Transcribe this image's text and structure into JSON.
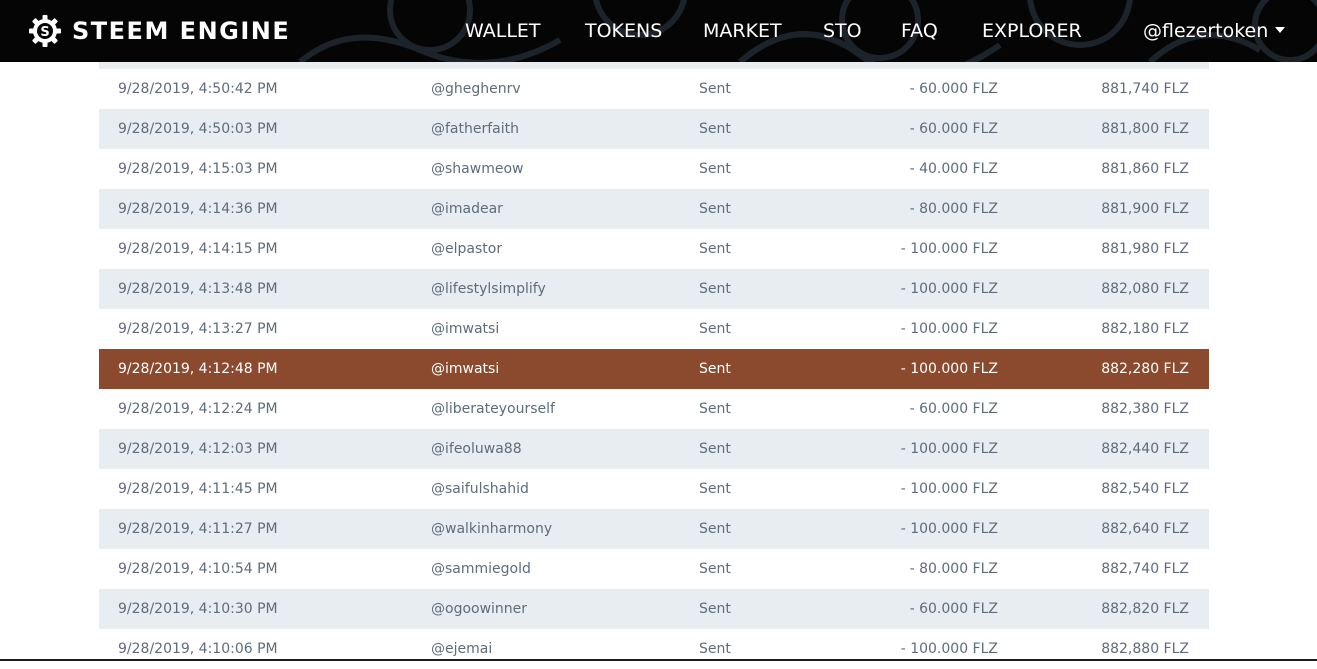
{
  "header": {
    "brand": "STEEM ENGINE",
    "nav": [
      "WALLET",
      "TOKENS",
      "MARKET",
      "STO",
      "FAQ",
      "EXPLORER"
    ],
    "user": "@flezertoken"
  },
  "colors": {
    "navbar_bg": "#050505",
    "row_alt_bg": "#e8edf1",
    "row_selected_bg": "#8b4a2e",
    "text": "#5e6c7b"
  },
  "transactions": [
    {
      "date": "9/28/2019, 4:50:42 PM",
      "user": "@gheghenrv",
      "type": "Sent",
      "amount": "- 60.000 FLZ",
      "balance": "881,740 FLZ"
    },
    {
      "date": "9/28/2019, 4:50:03 PM",
      "user": "@fatherfaith",
      "type": "Sent",
      "amount": "- 60.000 FLZ",
      "balance": "881,800 FLZ"
    },
    {
      "date": "9/28/2019, 4:15:03 PM",
      "user": "@shawmeow",
      "type": "Sent",
      "amount": "- 40.000 FLZ",
      "balance": "881,860 FLZ"
    },
    {
      "date": "9/28/2019, 4:14:36 PM",
      "user": "@imadear",
      "type": "Sent",
      "amount": "- 80.000 FLZ",
      "balance": "881,900 FLZ"
    },
    {
      "date": "9/28/2019, 4:14:15 PM",
      "user": "@elpastor",
      "type": "Sent",
      "amount": "- 100.000 FLZ",
      "balance": "881,980 FLZ"
    },
    {
      "date": "9/28/2019, 4:13:48 PM",
      "user": "@lifestylsimplify",
      "type": "Sent",
      "amount": "- 100.000 FLZ",
      "balance": "882,080 FLZ"
    },
    {
      "date": "9/28/2019, 4:13:27 PM",
      "user": "@imwatsi",
      "type": "Sent",
      "amount": "- 100.000 FLZ",
      "balance": "882,180 FLZ"
    },
    {
      "date": "9/28/2019, 4:12:48 PM",
      "user": "@imwatsi",
      "type": "Sent",
      "amount": "- 100.000 FLZ",
      "balance": "882,280 FLZ"
    },
    {
      "date": "9/28/2019, 4:12:24 PM",
      "user": "@liberateyourself",
      "type": "Sent",
      "amount": "- 60.000 FLZ",
      "balance": "882,380 FLZ"
    },
    {
      "date": "9/28/2019, 4:12:03 PM",
      "user": "@ifeoluwa88",
      "type": "Sent",
      "amount": "- 100.000 FLZ",
      "balance": "882,440 FLZ"
    },
    {
      "date": "9/28/2019, 4:11:45 PM",
      "user": "@saifulshahid",
      "type": "Sent",
      "amount": "- 100.000 FLZ",
      "balance": "882,540 FLZ"
    },
    {
      "date": "9/28/2019, 4:11:27 PM",
      "user": "@walkinharmony",
      "type": "Sent",
      "amount": "- 100.000 FLZ",
      "balance": "882,640 FLZ"
    },
    {
      "date": "9/28/2019, 4:10:54 PM",
      "user": "@sammiegold",
      "type": "Sent",
      "amount": "- 80.000 FLZ",
      "balance": "882,740 FLZ"
    },
    {
      "date": "9/28/2019, 4:10:30 PM",
      "user": "@ogoowinner",
      "type": "Sent",
      "amount": "- 60.000 FLZ",
      "balance": "882,820 FLZ"
    },
    {
      "date": "9/28/2019, 4:10:06 PM",
      "user": "@ejemai",
      "type": "Sent",
      "amount": "- 100.000 FLZ",
      "balance": "882,880 FLZ"
    }
  ]
}
